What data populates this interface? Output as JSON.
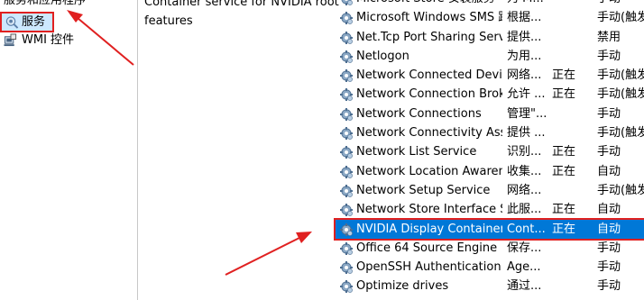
{
  "tree": {
    "top_label": "服务和应用程序",
    "services_label": "服务",
    "wmi_label": "WMI 控件"
  },
  "description": {
    "line1": "Container service for NVIDIA root",
    "line2": "features"
  },
  "services": [
    {
      "name": "Microsoft Store 安装服务",
      "desc": "为 M...",
      "status": "",
      "startup": "手动"
    },
    {
      "name": "Microsoft Windows SMS 路...",
      "desc": "根据...",
      "status": "",
      "startup": "手动(触发"
    },
    {
      "name": "Net.Tcp Port Sharing Service",
      "desc": "提供...",
      "status": "",
      "startup": "禁用"
    },
    {
      "name": "Netlogon",
      "desc": "为用...",
      "status": "",
      "startup": "手动"
    },
    {
      "name": "Network Connected Devic...",
      "desc": "网络...",
      "status": "正在",
      "startup": "手动(触发"
    },
    {
      "name": "Network Connection Broker",
      "desc": "允许 ...",
      "status": "正在",
      "startup": "手动(触发"
    },
    {
      "name": "Network Connections",
      "desc": "管理\"...",
      "status": "",
      "startup": "手动"
    },
    {
      "name": "Network Connectivity Assis...",
      "desc": "提供 ...",
      "status": "",
      "startup": "手动(触发"
    },
    {
      "name": "Network List Service",
      "desc": "识别...",
      "status": "正在",
      "startup": "手动"
    },
    {
      "name": "Network Location Awarene",
      "desc": "收集...",
      "status": "正在",
      "startup": "自动"
    },
    {
      "name": "Network Setup Service",
      "desc": "网络...",
      "status": "",
      "startup": "手动(触发"
    },
    {
      "name": "Network Store Interface Se...",
      "desc": "此服...",
      "status": "正在",
      "startup": "自动"
    },
    {
      "name": "NVIDIA Display Container LS",
      "desc": "Cont...",
      "status": "正在",
      "startup": "自动"
    },
    {
      "name": "Office 64 Source Engine",
      "desc": "保存...",
      "status": "",
      "startup": "手动"
    },
    {
      "name": "OpenSSH Authentication ...",
      "desc": "Age...",
      "status": "",
      "startup": "手动"
    },
    {
      "name": "Optimize drives",
      "desc": "通过...",
      "status": "",
      "startup": "手动"
    }
  ],
  "selected_index": 12,
  "colors": {
    "selection": "#0078d7",
    "highlight_box": "#e02020",
    "arrow": "#e02020"
  },
  "icons": {
    "service": "gear-icon",
    "services_node": "services-icon",
    "wmi_node": "wmi-icon"
  }
}
